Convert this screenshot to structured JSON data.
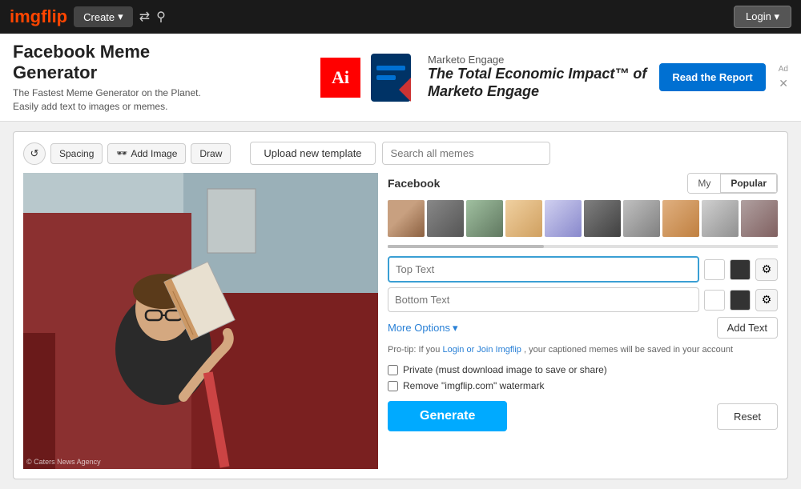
{
  "navbar": {
    "logo_img": "img",
    "logo_text": "flip",
    "create_label": "Create",
    "login_label": "Login"
  },
  "ad": {
    "close_label": "⊗",
    "ad_label": "Ad",
    "brand": "Marketo Engage",
    "headline": "The Total Economic Impact™ of",
    "headline2": "Marketo Engage",
    "cta_label": "Read the Report",
    "logo_text": "Ai"
  },
  "page": {
    "title": "Facebook Meme Generator",
    "subtitle": "The Fastest Meme Generator on the Planet. Easily add text to images or memes."
  },
  "toolbar": {
    "spacing_label": "Spacing",
    "add_image_label": "Add Image",
    "draw_label": "Draw",
    "upload_label": "Upload new template",
    "search_placeholder": "Search all memes"
  },
  "right_panel": {
    "section_label": "Facebook",
    "tab_my": "My",
    "tab_popular": "Popular",
    "top_text_placeholder": "Top Text",
    "bottom_text_placeholder": "Bottom Text",
    "more_options": "More Options",
    "add_text": "Add Text",
    "pro_tip": "Pro-tip: If you",
    "pro_tip_link": "Login or Join Imgflip",
    "pro_tip_end": ", your captioned memes will be saved in your account",
    "private_label": "Private (must download image to save or share)",
    "watermark_label": "Remove \"imgflip.com\" watermark",
    "generate_label": "Generate",
    "reset_label": "Reset"
  },
  "img_credit": "© Caters News Agency",
  "thumbs": [
    {
      "id": 1,
      "class": "thumb-1"
    },
    {
      "id": 2,
      "class": "thumb-2"
    },
    {
      "id": 3,
      "class": "thumb-3"
    },
    {
      "id": 4,
      "class": "thumb-4"
    },
    {
      "id": 5,
      "class": "thumb-5"
    },
    {
      "id": 6,
      "class": "thumb-6"
    },
    {
      "id": 7,
      "class": "thumb-7"
    },
    {
      "id": 8,
      "class": "thumb-8"
    },
    {
      "id": 9,
      "class": "thumb-9"
    },
    {
      "id": 10,
      "class": "thumb-10"
    }
  ]
}
